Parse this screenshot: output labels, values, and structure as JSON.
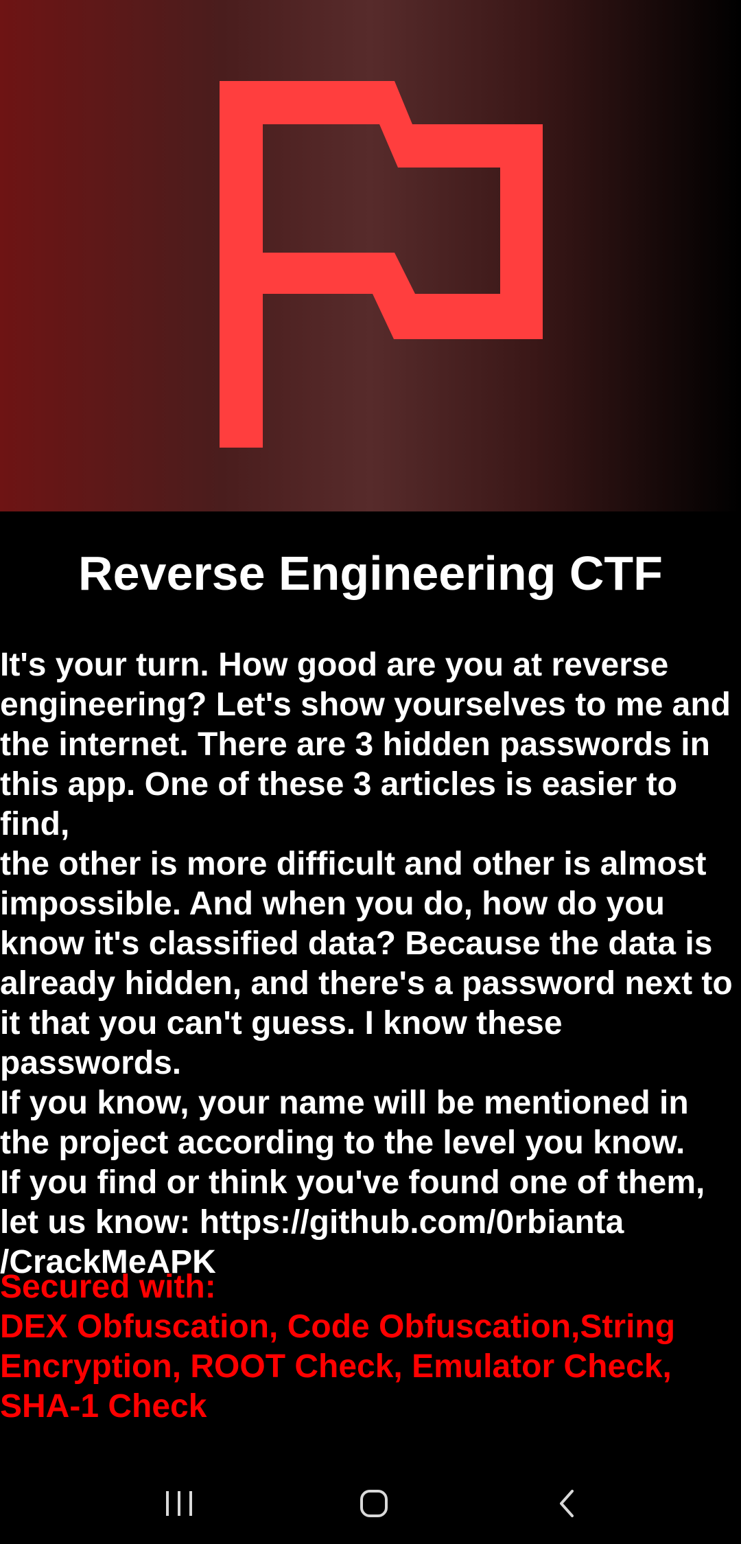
{
  "theme": {
    "accent": "#ff3e3e",
    "warning": "#ff0000",
    "background": "#000000",
    "text": "#ffffff"
  },
  "hero": {
    "logo_icon": "flag-icon"
  },
  "title": "Reverse Engineering CTF",
  "body_text": "It's your turn. How good are you at reverse\nengineering? Let's show yourselves to me and\nthe internet. There are 3 hidden passwords in\nthis app. One of these 3 articles is easier to find,\nthe other is more difficult and other is almost\nimpossible. And when you do, how do you\nknow it's classified data? Because the data is\nalready hidden, and there's a password next to\nit that you can't guess. I know these passwords.\nIf you know, your name will be mentioned in\nthe project according to the level you know.\nIf you find or think you've found one of them,\nlet us know: https://github.com/0rbianta\n/CrackMeAPK",
  "security_text": "Secured with:\nDEX Obfuscation, Code Obfuscation,String\nEncryption, ROOT Check, Emulator Check,\nSHA-1 Check",
  "navbar": {
    "recent_icon": "recent-apps-icon",
    "home_icon": "home-icon",
    "back_icon": "back-icon"
  }
}
